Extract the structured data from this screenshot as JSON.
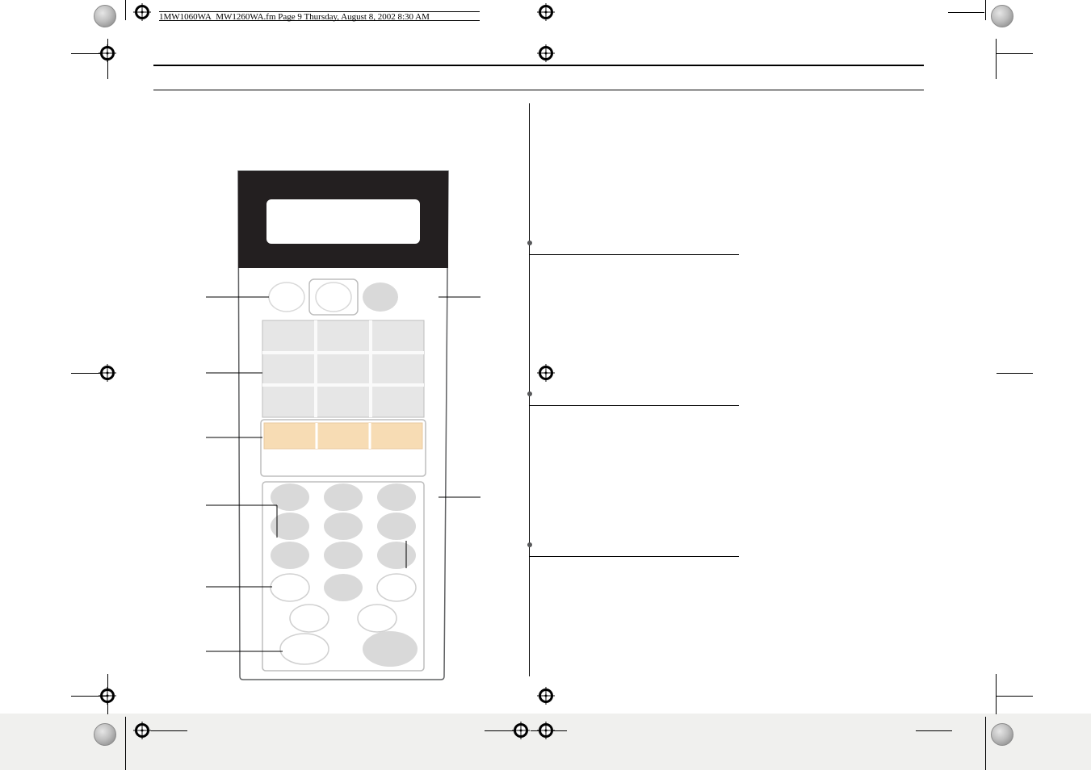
{
  "header": {
    "doc_info": "1MW1060WA_MW1260WA.fm  Page 9  Thursday, August 8, 2002  8:30 AM"
  }
}
